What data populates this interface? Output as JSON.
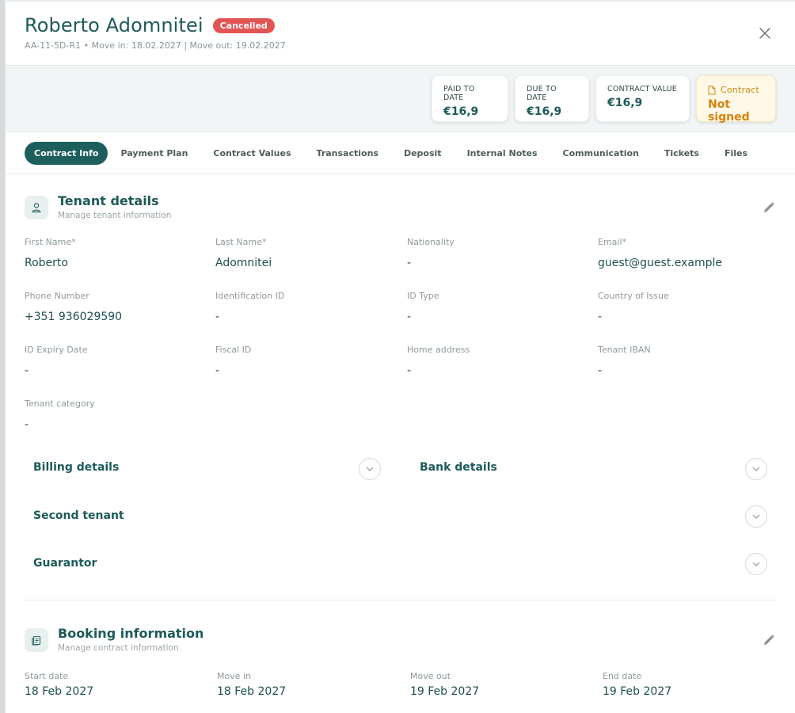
{
  "header": {
    "name": "Roberto Adomnitei",
    "status": "Cancelled",
    "subtitle": "AA-11-5D-R1 • Move in: 18.02.2027 | Move out: 19.02.2027"
  },
  "summary": {
    "paid_label": "PAID TO DATE",
    "paid_value": "€16,9",
    "due_label": "DUE TO DATE",
    "due_value": "€16,9",
    "contract_value_label": "CONTRACT VALUE",
    "contract_value_value": "€16,9",
    "contract_label": "Contract",
    "contract_status": "Not signed"
  },
  "tabs": [
    {
      "label": "Contract Info"
    },
    {
      "label": "Payment Plan"
    },
    {
      "label": "Contract Values"
    },
    {
      "label": "Transactions"
    },
    {
      "label": "Deposit"
    },
    {
      "label": "Internal Notes"
    },
    {
      "label": "Communication"
    },
    {
      "label": "Tickets"
    },
    {
      "label": "Files"
    }
  ],
  "tenant": {
    "title": "Tenant details",
    "subtitle": "Manage tenant information",
    "fields": [
      {
        "label": "First Name*",
        "value": "Roberto"
      },
      {
        "label": "Last Name*",
        "value": "Adomnitei"
      },
      {
        "label": "Nationality",
        "value": "-"
      },
      {
        "label": "Email*",
        "value": "guest@guest.example"
      },
      {
        "label": "Phone Number",
        "value": "+351 936029590"
      },
      {
        "label": "Identification ID",
        "value": "-"
      },
      {
        "label": "ID Type",
        "value": "-"
      },
      {
        "label": "Country of Issue",
        "value": "-"
      },
      {
        "label": "ID Expiry Date",
        "value": "-"
      },
      {
        "label": "Fiscal ID",
        "value": "-"
      },
      {
        "label": "Home address",
        "value": "-"
      },
      {
        "label": "Tenant IBAN",
        "value": "-"
      },
      {
        "label": "Tenant category",
        "value": "-"
      }
    ],
    "billing_details": "Billing details",
    "bank_details": "Bank details",
    "second_tenant": "Second tenant",
    "guarantor": "Guarantor"
  },
  "booking": {
    "title": "Booking information",
    "subtitle": "Manage contract information",
    "fields": [
      {
        "label": "Start date",
        "value": "18 Feb 2027"
      },
      {
        "label": "Move in",
        "value": "18 Feb 2027"
      },
      {
        "label": "Move out",
        "value": "19 Feb 2027"
      },
      {
        "label": "End date",
        "value": "19 Feb 2027"
      }
    ]
  }
}
